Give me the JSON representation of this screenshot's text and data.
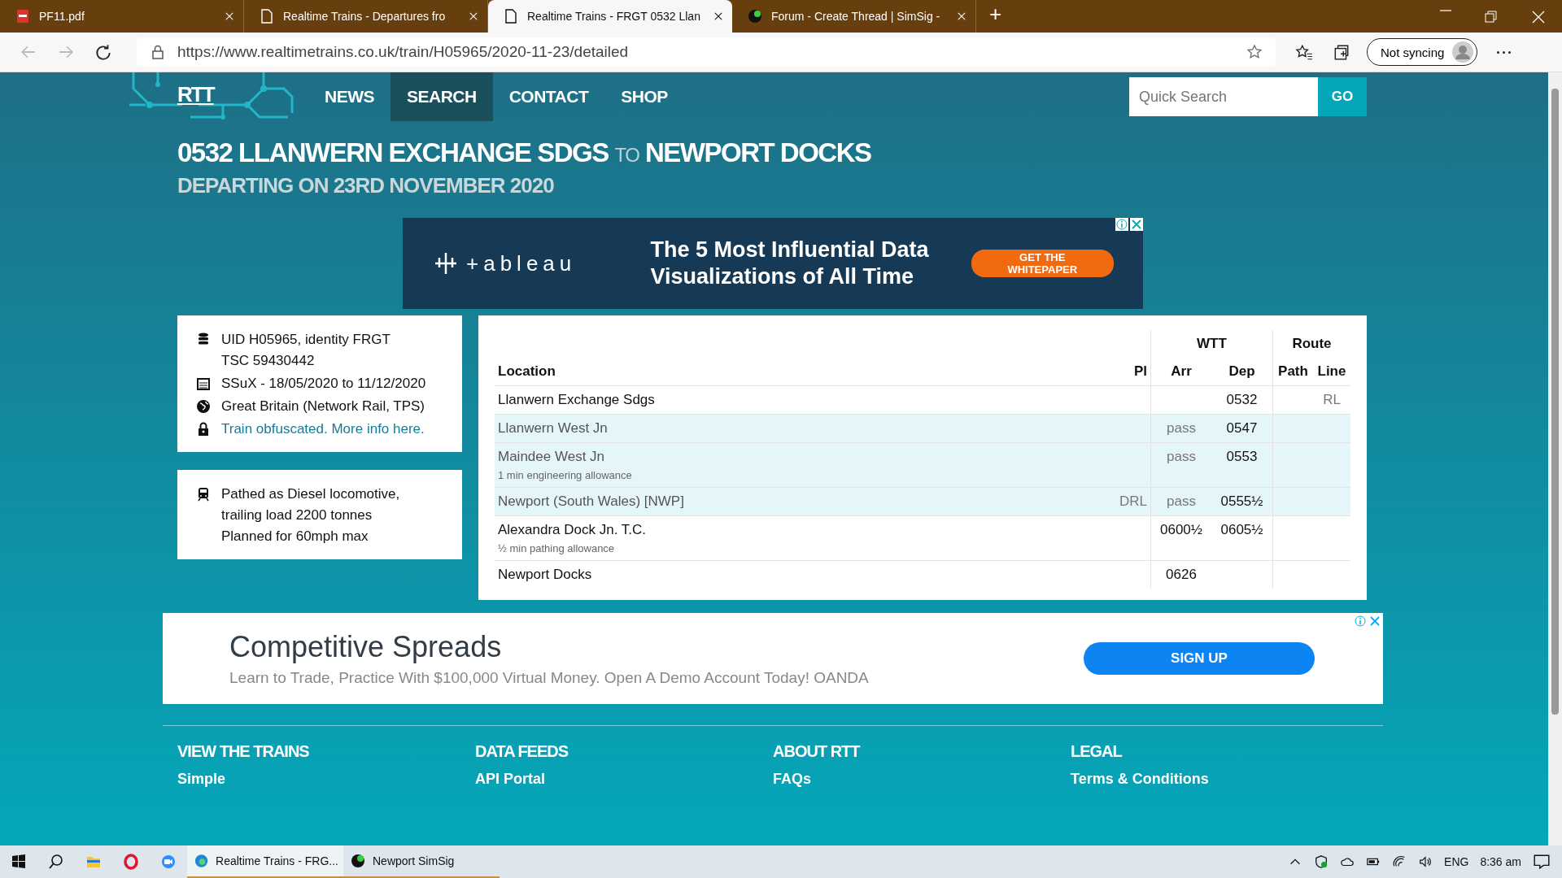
{
  "browser": {
    "tabs": [
      {
        "title": "PF11.pdf",
        "selected": false
      },
      {
        "title": "Realtime Trains - Departures fro",
        "selected": false
      },
      {
        "title": "Realtime Trains - FRGT 0532 Llan",
        "selected": true
      },
      {
        "title": "Forum - Create Thread | SimSig -",
        "selected": false
      }
    ],
    "new_tab": "+",
    "url": "https://www.realtimetrains.co.uk/train/H05965/2020-11-23/detailed",
    "profile": "Not syncing"
  },
  "site": {
    "logo": "RTT",
    "nav": [
      {
        "label": "NEWS",
        "selected": false
      },
      {
        "label": "SEARCH",
        "selected": true
      },
      {
        "label": "CONTACT",
        "selected": false
      },
      {
        "label": "SHOP",
        "selected": false
      }
    ],
    "search": {
      "placeholder": "Quick Search",
      "button": "GO"
    }
  },
  "heading": {
    "origin": "0532 LLANWERN EXCHANGE SDGS",
    "joiner": "TO",
    "destination": "NEWPORT DOCKS",
    "subtitle": "DEPARTING ON 23RD NOVEMBER 2020"
  },
  "ad_top": {
    "logo": "+ableau",
    "headline": "The 5 Most Influential Data Visualizations of All Time",
    "button": "GET THE WHITEPAPER"
  },
  "info": [
    {
      "lines": [
        "UID H05965, identity FRGT",
        "TSC 59430442"
      ]
    },
    {
      "lines": [
        "SSuX - 18/05/2020 to 11/12/2020"
      ]
    },
    {
      "lines": [
        "Great Britain (Network Rail, TPS)"
      ]
    },
    {
      "link": "Train obfuscated. More info here."
    }
  ],
  "traction": {
    "lines": [
      "Pathed as Diesel locomotive,",
      "trailing load 2200 tonnes",
      "Planned for 60mph max"
    ]
  },
  "table": {
    "groups": [
      "WTT",
      "Route"
    ],
    "columns": [
      "Location",
      "Pl",
      "Arr",
      "Dep",
      "Path",
      "Line"
    ],
    "rows": [
      {
        "location": "Llanwern Exchange Sdgs",
        "highlighted": false,
        "dep": "0532",
        "line": "RL"
      },
      {
        "location": "Llanwern West Jn",
        "highlighted": true,
        "arr": "pass",
        "dep": "0547"
      },
      {
        "location": "Maindee West Jn",
        "note": "1 min engineering allowance",
        "highlighted": true,
        "arr": "pass",
        "dep": "0553"
      },
      {
        "location": "Newport (South Wales) [NWP]",
        "highlighted": true,
        "pl": "DRL",
        "arr": "pass",
        "dep": "0555½"
      },
      {
        "location": "Alexandra Dock Jn. T.C.",
        "note": "½ min pathing allowance",
        "highlighted": false,
        "arr": "0600½",
        "dep": "0605½"
      },
      {
        "location": "Newport Docks",
        "highlighted": false,
        "arr": "0626"
      }
    ]
  },
  "ad_bottom": {
    "headline": "Competitive Spreads",
    "text": "Learn to Trade, Practice With $100,000 Virtual Money. Open A Demo Account Today! OANDA",
    "button": "SIGN UP"
  },
  "footer": [
    {
      "heading": "VIEW THE TRAINS",
      "link": "Simple"
    },
    {
      "heading": "DATA FEEDS",
      "link": "API Portal"
    },
    {
      "heading": "ABOUT RTT",
      "link": "FAQs"
    },
    {
      "heading": "LEGAL",
      "link": "Terms & Conditions"
    }
  ],
  "taskbar": {
    "apps": [
      {
        "label": "Realtime Trains - FRG...",
        "selected": true
      },
      {
        "label": "Newport SimSig",
        "selected": false
      }
    ],
    "language": "ENG",
    "time": "8:36 am"
  }
}
